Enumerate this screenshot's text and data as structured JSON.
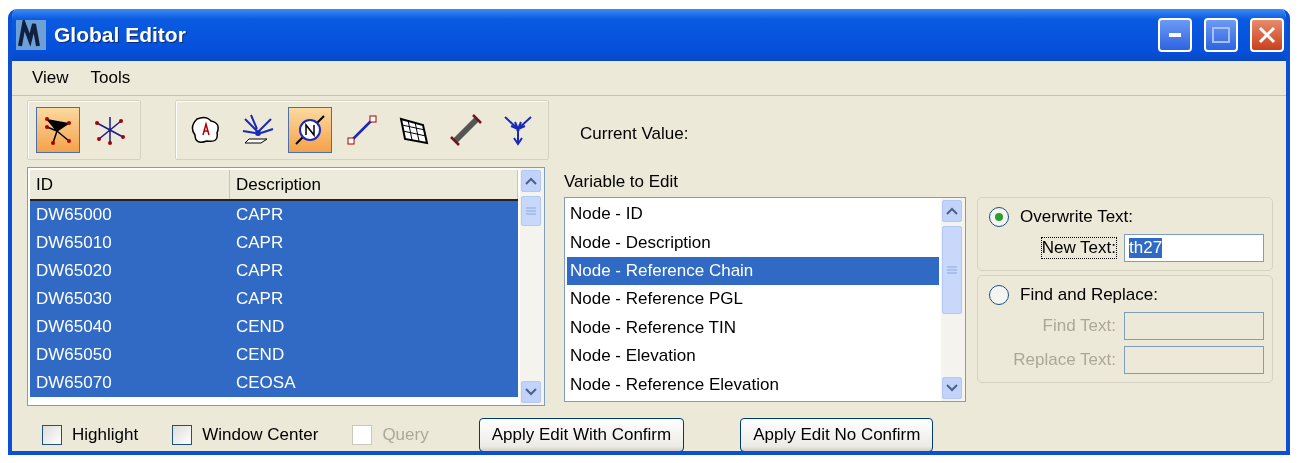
{
  "window": {
    "title": "Global Editor"
  },
  "menu": [
    "View",
    "Tools"
  ],
  "toolbar_groups": [
    {
      "tools": [
        {
          "selected": true
        },
        {
          "selected": false
        }
      ]
    },
    {
      "tools": [
        {
          "selected": false
        },
        {
          "selected": false
        },
        {
          "selected": true
        },
        {
          "selected": false
        },
        {
          "selected": false
        },
        {
          "selected": false
        },
        {
          "selected": false
        }
      ]
    }
  ],
  "current_value_label": "Current Value:",
  "table": {
    "columns": [
      "ID",
      "Description"
    ],
    "rows": [
      {
        "id": "DW65000",
        "description": "CAPR",
        "selected": true
      },
      {
        "id": "DW65010",
        "description": "CAPR",
        "selected": true
      },
      {
        "id": "DW65020",
        "description": "CAPR",
        "selected": true
      },
      {
        "id": "DW65030",
        "description": "CAPR",
        "selected": true
      },
      {
        "id": "DW65040",
        "description": "CEND",
        "selected": true
      },
      {
        "id": "DW65050",
        "description": "CEND",
        "selected": true
      },
      {
        "id": "DW65070",
        "description": "CEOSA",
        "selected": true
      }
    ]
  },
  "variable_list": {
    "label": "Variable to Edit",
    "items": [
      {
        "label": "Node - ID",
        "selected": false
      },
      {
        "label": "Node - Description",
        "selected": false
      },
      {
        "label": "Node - Reference Chain",
        "selected": true
      },
      {
        "label": "Node - Reference PGL",
        "selected": false
      },
      {
        "label": "Node - Reference TIN",
        "selected": false
      },
      {
        "label": "Node - Elevation",
        "selected": false
      },
      {
        "label": "Node - Reference Elevation",
        "selected": false
      }
    ]
  },
  "modes": [
    {
      "label": "Overwrite Text:",
      "selected": true,
      "fields": [
        {
          "label": "New Text:",
          "value": "th27",
          "disabled": false
        }
      ]
    },
    {
      "label": "Find and Replace:",
      "selected": false,
      "fields": [
        {
          "label": "Find Text:",
          "disabled": true
        },
        {
          "label": "Replace Text:",
          "disabled": true
        }
      ]
    }
  ],
  "options": [
    {
      "label": "Highlight",
      "checked": false,
      "disabled": false
    },
    {
      "label": "Window Center",
      "checked": false,
      "disabled": false
    },
    {
      "label": "Query",
      "checked": false,
      "disabled": true
    }
  ],
  "buttons": [
    "Apply Edit With Confirm",
    "Apply Edit No Confirm"
  ]
}
